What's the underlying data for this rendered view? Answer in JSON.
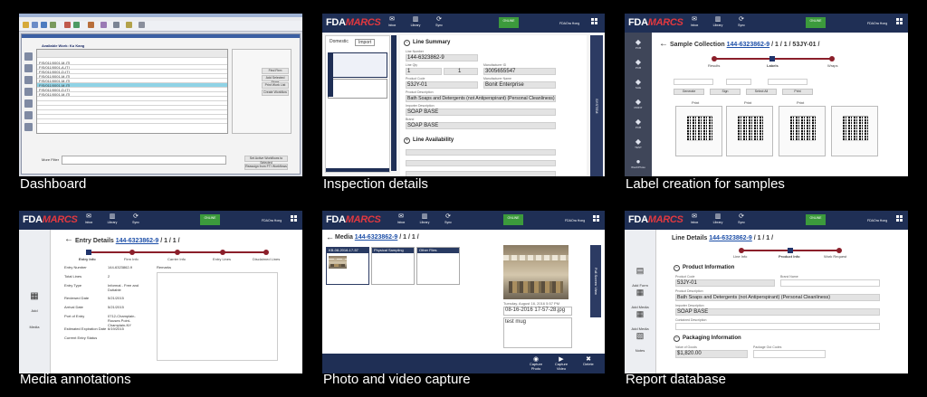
{
  "captions": [
    "Dashboard",
    "Inspection details",
    "Label creation for samples",
    "Media annotations",
    "Photo and video capture",
    "Report database"
  ],
  "brand": {
    "logo_prefix": "FDA",
    "logo_suffix": "MARCS",
    "accent": "#e2383f",
    "header_bg": "#1f2f55"
  },
  "header": {
    "inbox": "Inbox",
    "library": "Library",
    "sync": "Sync",
    "online": "ONLINE",
    "user": "FDAOra Hong"
  },
  "dashboard": {
    "panel_title": "Available Work: Ku Kang",
    "buttons": [
      "Find Firm",
      "Add Selected Firms",
      "Print Work List",
      "Create Workflow"
    ],
    "rows": [
      "FIS/011/0001-M-ITI",
      "FIS/011/0001-A-ITI",
      "FIS/011/0001-D-ITI",
      "FIS/011/0001-M-ITI",
      "FIS/011/0001-M-ITI",
      "FIS/011/0001-M-ITI",
      "FIS/011/0001-D-ITI",
      "FIS/011/0001-M-ITI"
    ],
    "more_filter": "More Filter",
    "footer_buttons": [
      "Set Active Workflows to Selected",
      "Reassign from FTI Workflows"
    ]
  },
  "inspection": {
    "tabs": [
      "Domestic",
      "Import"
    ],
    "line_summary": "Line Summary",
    "line_number_label": "Line Number",
    "line_number": "144-6323862-9",
    "line_qty_label": "Line Qty",
    "qty_a": "1",
    "qty_b": "1",
    "manufacturer_id_label": "Manufacturer ID",
    "manufacturer_id": "3005655547",
    "product_code_label": "Product Code",
    "product_code": "53JY-01",
    "manufacturer_name_label": "Manufacturer Name",
    "manufacturer_name": "Bonit Enterprise",
    "product_desc_label": "Product Description",
    "product_desc": "Bath Soaps and Detergents (not Antiperspirant) (Personal Cleanliness)",
    "importer_desc_label": "Importer Description",
    "importer_desc": "SOAP BASE",
    "brand_label": "Brand",
    "brand": "SOAP BASE",
    "line_availability": "Line Availability",
    "side_tab": "SYSTEM"
  },
  "label": {
    "title": "Sample Collection",
    "entry_link": "144-6323862-9",
    "path": " / 1 / 1 / 53JY-01 / ",
    "steps": [
      "Results",
      "Labels",
      "Wraps"
    ],
    "buttons": [
      "Generate",
      "Sign",
      "Select All",
      "Print"
    ],
    "print_labels": [
      "Print",
      "Print",
      "Print"
    ],
    "sidebar": [
      "PCB",
      "PCB",
      "SHE",
      "PRINT",
      "PCB",
      "TEST",
      "Word/Photo"
    ]
  },
  "media": {
    "title": "Entry Details",
    "entry_link": "144-6323862-9",
    "path": " / 1 / 1 /",
    "steps": [
      "Entry Info",
      "Firm Info",
      "Carrier Info",
      "Entry Lines",
      "Disclaimed Lines"
    ],
    "fields": [
      {
        "label": "Entry Number",
        "value": "144-6323862-9"
      },
      {
        "label": "Total Lines",
        "value": "2"
      },
      {
        "label": "Entry Type",
        "value": "Informal - Free and Dutiable"
      },
      {
        "label": "Reviewed Date",
        "value": "5/21/2015"
      },
      {
        "label": "Arrival Date",
        "value": "5/21/2015"
      },
      {
        "label": "Port of Entry",
        "value": "0712-Champlain-Rouses Point-Champlain-NY"
      },
      {
        "label": "Estimated Expiration Date",
        "value": "6/19/2015"
      },
      {
        "label": "Current Entry Status",
        "value": ""
      }
    ],
    "remarks_label": "Remarks",
    "left_icon_label": "Add Media"
  },
  "photo": {
    "title": "Media",
    "entry_link": "144-6323862-9",
    "path": " / 1 / 1 /",
    "cards": [
      "KB-08-2016-17-57",
      "Physical Sampling",
      "Other Files"
    ],
    "caption_date": "Tuesday, August 16, 2016 5:57 PM",
    "file_name": "08-16-2016 17-57-28.jpg",
    "note": "test mug",
    "side_tab": "Full Screen View",
    "footer": [
      "Capture Photo",
      "Capture Video",
      "Delete"
    ]
  },
  "report": {
    "title": "Line Details",
    "entry_link": "144-6323862-9",
    "path": " / 1 / 1 /",
    "steps": [
      "Line Info",
      "Product Info",
      "Work Request"
    ],
    "product_info": "Product Information",
    "product_code_label": "Product Code",
    "product_code": "53JY-01",
    "brand_name_label": "Brand Name",
    "product_desc_label": "Product Description",
    "product_desc": "Bath Soaps and Detergents (not Antiperspirant) (Personal Cleanliness)",
    "importer_desc_label": "Importer Description",
    "importer_desc": "SOAP BASE",
    "contained_label": "Contained Description",
    "packaging_info": "Packaging Information",
    "value_label": "Value of Goods",
    "value": "$1,820.00",
    "package_codes_label": "Package Out Codes",
    "sidebar": [
      "Add Form",
      "Add Media",
      "Add Media",
      "Notes"
    ]
  }
}
